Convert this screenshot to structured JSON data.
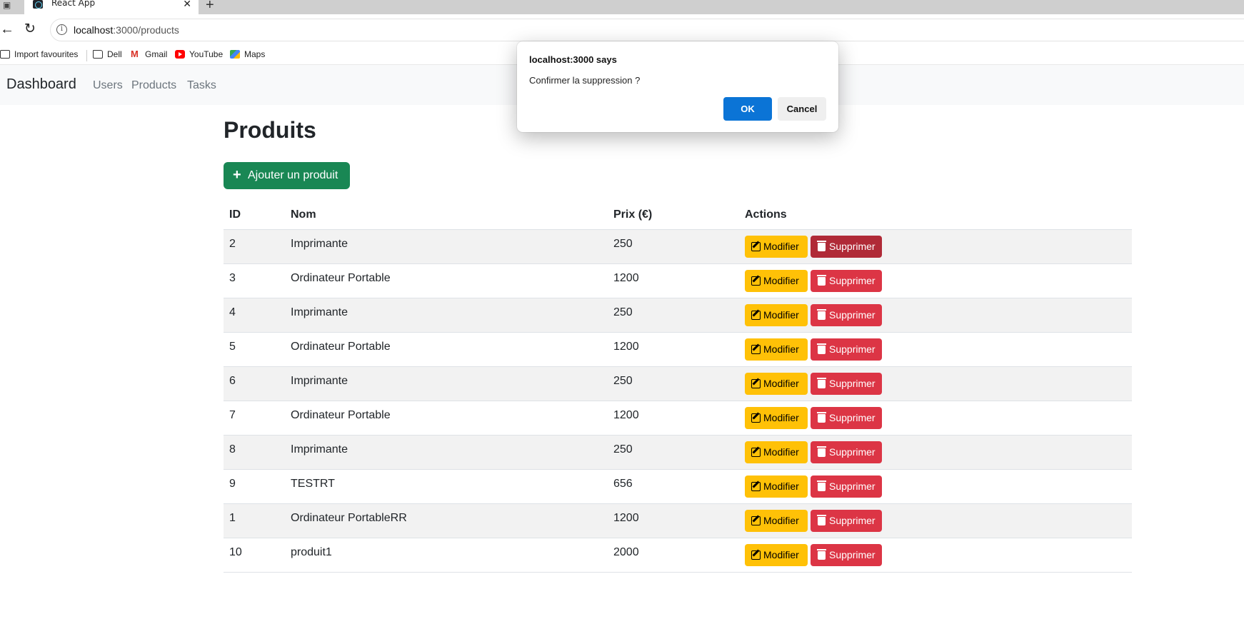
{
  "browser": {
    "tab_title": "React App",
    "url_host": "localhost",
    "url_path": ":3000/products",
    "bookmarks": [
      "Import favourites",
      "Dell",
      "Gmail",
      "YouTube",
      "Maps"
    ]
  },
  "navbar": {
    "brand": "Dashboard",
    "links": [
      "Users",
      "Products",
      "Tasks"
    ]
  },
  "page": {
    "title": "Produits",
    "add_button": "Ajouter un produit"
  },
  "table": {
    "headers": [
      "ID",
      "Nom",
      "Prix (€)",
      "Actions"
    ],
    "edit_label": "Modifier",
    "delete_label": "Supprimer",
    "rows": [
      {
        "id": "2",
        "nom": "Imprimante",
        "prix": "250"
      },
      {
        "id": "3",
        "nom": "Ordinateur Portable",
        "prix": "1200"
      },
      {
        "id": "4",
        "nom": "Imprimante",
        "prix": "250"
      },
      {
        "id": "5",
        "nom": "Ordinateur Portable",
        "prix": "1200"
      },
      {
        "id": "6",
        "nom": "Imprimante",
        "prix": "250"
      },
      {
        "id": "7",
        "nom": "Ordinateur Portable",
        "prix": "1200"
      },
      {
        "id": "8",
        "nom": "Imprimante",
        "prix": "250"
      },
      {
        "id": "9",
        "nom": "TESTRT",
        "prix": "656"
      },
      {
        "id": "1",
        "nom": "Ordinateur PortableRR",
        "prix": "1200"
      },
      {
        "id": "10",
        "nom": "produit1",
        "prix": "2000"
      }
    ]
  },
  "dialog": {
    "title": "localhost:3000 says",
    "message": "Confirmer la suppression ?",
    "ok": "OK",
    "cancel": "Cancel"
  },
  "colors": {
    "success": "#198754",
    "warning": "#ffc107",
    "danger": "#dc3545",
    "dialog_ok": "#0b74d6"
  }
}
